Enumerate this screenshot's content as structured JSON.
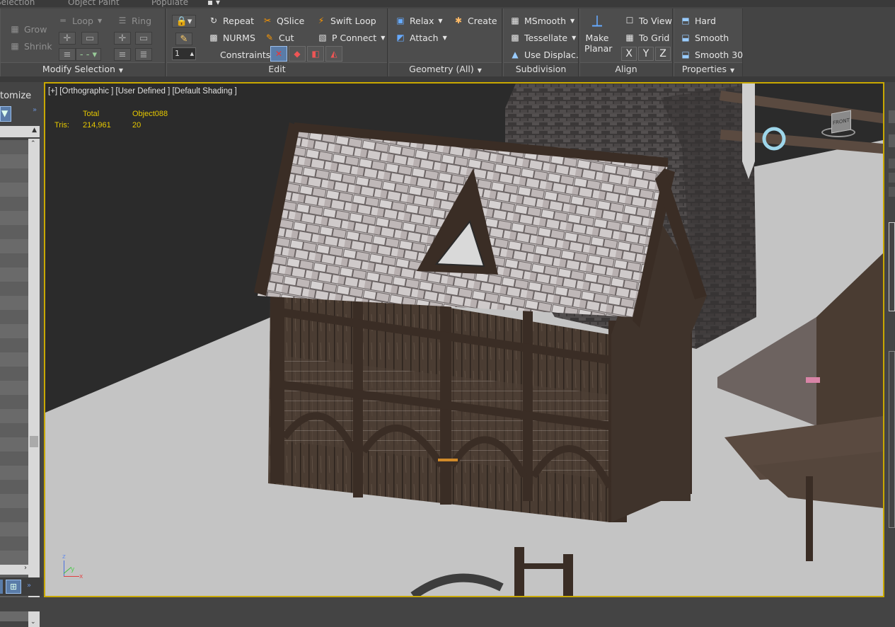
{
  "top_tabs": [
    "Selection",
    "Object Paint",
    "Populate"
  ],
  "modify_selection": {
    "footer": "Modify Selection",
    "grow": "Grow",
    "shrink": "Shrink",
    "loop": "Loop",
    "ring": "Ring"
  },
  "edit": {
    "footer": "Edit",
    "repeat": "Repeat",
    "nurms": "NURMS",
    "qslice": "QSlice",
    "cut": "Cut",
    "swift_loop": "Swift Loop",
    "p_connect": "P Connect",
    "constraints": "Constraints:",
    "spinner_value": "1"
  },
  "geometry": {
    "footer": "Geometry (All)",
    "relax": "Relax",
    "create": "Create",
    "attach": "Attach"
  },
  "subdivision": {
    "footer": "Subdivision",
    "msmooth": "MSmooth",
    "tessellate": "Tessellate",
    "use_displace": "Use Displac..."
  },
  "align": {
    "footer": "Align",
    "make_planar": "Make Planar",
    "make_planar_l1": "Make",
    "make_planar_l2": "Planar",
    "to_view": "To View",
    "to_grid": "To Grid",
    "x": "X",
    "y": "Y",
    "z": "Z"
  },
  "properties": {
    "footer": "Properties",
    "hard": "Hard",
    "smooth": "Smooth",
    "smooth30": "Smooth 30"
  },
  "left_panel": {
    "title": "tomize"
  },
  "viewport": {
    "label": "[+] [Orthographic ] [User Defined ] [Default Shading ]",
    "stats": {
      "col_total": "Total",
      "col_object": "Object088",
      "row_label": "Tris:",
      "total_value": "214,961",
      "object_value": "20"
    },
    "viewcube_label": "FRONT",
    "axis": {
      "x": "x",
      "y": "y",
      "z": "z"
    }
  },
  "colors": {
    "viewport_border": "#c8a800",
    "stats_text": "#e6c800",
    "ribbon_bg": "#4d4d4d"
  }
}
